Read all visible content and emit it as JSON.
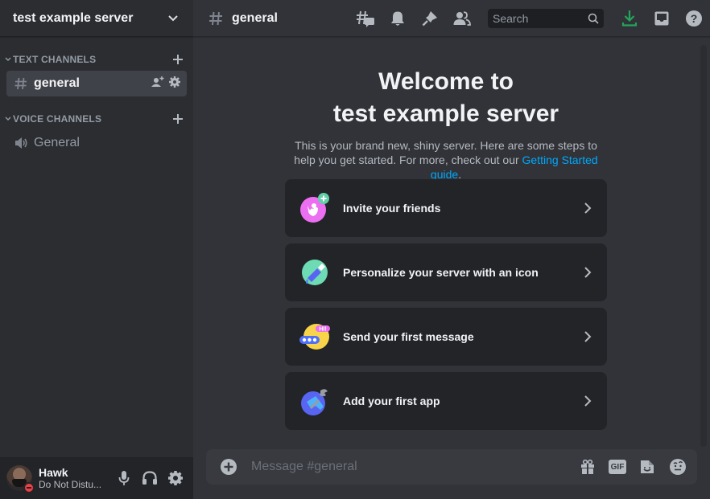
{
  "sidebar": {
    "server_name": "test example server",
    "categories": [
      {
        "label": "TEXT CHANNELS",
        "channels": [
          {
            "name": "general",
            "type": "text",
            "active": true
          }
        ]
      },
      {
        "label": "VOICE CHANNELS",
        "channels": [
          {
            "name": "General",
            "type": "voice",
            "active": false
          }
        ]
      }
    ],
    "user": {
      "name": "Hawk",
      "status": "Do Not Distu...",
      "status_color": "#f23f43"
    }
  },
  "topbar": {
    "channel_name": "general",
    "icons": [
      "threads-icon",
      "notification-bell-icon",
      "pinned-messages-icon",
      "member-list-icon"
    ],
    "search_placeholder": "Search",
    "right_icons": [
      "download-icon",
      "inbox-icon",
      "help-icon"
    ],
    "download_color": "#23a55a"
  },
  "welcome": {
    "title_line1": "Welcome to",
    "title_line2": "test example server",
    "description": "This is your brand new, shiny server. Here are some steps to help you get started. For more, check out our ",
    "link_text": "Getting Started guide",
    "trailing": ".",
    "link_color": "#00a8fc"
  },
  "cards": [
    {
      "label": "Invite your friends",
      "icon": "invite-friends-icon"
    },
    {
      "label": "Personalize your server with an icon",
      "icon": "personalize-icon"
    },
    {
      "label": "Send your first message",
      "icon": "send-message-icon"
    },
    {
      "label": "Add your first app",
      "icon": "add-app-icon"
    }
  ],
  "composer": {
    "placeholder": "Message #general",
    "gif_label": "GIF"
  }
}
